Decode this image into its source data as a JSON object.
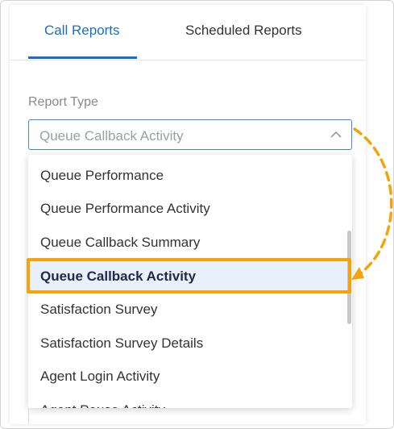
{
  "tabs": [
    {
      "label": "Call Reports",
      "active": true
    },
    {
      "label": "Scheduled Reports",
      "active": false
    }
  ],
  "report_type": {
    "label": "Report Type",
    "placeholder": "Queue Callback Activity",
    "open": true
  },
  "dropdown": {
    "options": [
      "Queue Performance",
      "Queue Performance Activity",
      "Queue Callback Summary",
      "Queue Callback Activity",
      "Satisfaction Survey",
      "Satisfaction Survey Details",
      "Agent Login Activity",
      "Agent Pause Activity"
    ],
    "selected_index": 3
  },
  "colors": {
    "accent": "#1a6fc3",
    "highlight": "#f5a30a",
    "selected_bg": "#e8f1fb"
  },
  "icons": {
    "select_chevron": "chevron-up-icon",
    "annotation": "dashed-curved-arrow-icon"
  }
}
